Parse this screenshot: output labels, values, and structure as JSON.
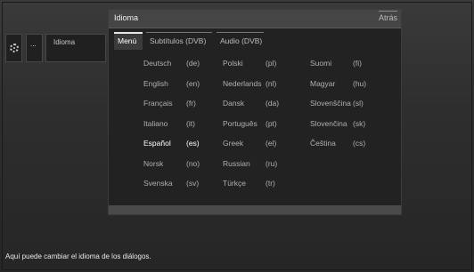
{
  "breadcrumb": {
    "item3_label": "Idioma",
    "item2_label": "..."
  },
  "panel": {
    "title": "Idioma",
    "back_label": "Atrás"
  },
  "tabs": [
    {
      "label": "Menú",
      "active": true
    },
    {
      "label": "Subtítulos (DVB)",
      "active": false
    },
    {
      "label": "Audio (DVB)",
      "active": false
    }
  ],
  "languages": {
    "col1": [
      {
        "name": "Deutsch",
        "code": "(de)"
      },
      {
        "name": "English",
        "code": "(en)"
      },
      {
        "name": "Français",
        "code": "(fr)"
      },
      {
        "name": "Italiano",
        "code": "(it)"
      },
      {
        "name": "Español",
        "code": "(es)",
        "selected": true
      },
      {
        "name": "Norsk",
        "code": "(no)"
      },
      {
        "name": "Svenska",
        "code": "(sv)"
      }
    ],
    "col2": [
      {
        "name": "Polski",
        "code": "(pl)"
      },
      {
        "name": "Nederlands",
        "code": "(nl)"
      },
      {
        "name": "Dansk",
        "code": "(da)"
      },
      {
        "name": "Português",
        "code": "(pt)"
      },
      {
        "name": "Greek",
        "code": "(el)"
      },
      {
        "name": "Russian",
        "code": "(ru)"
      },
      {
        "name": "Türkçe",
        "code": "(tr)"
      }
    ],
    "col3": [
      {
        "name": "Suomi",
        "code": "(fi)"
      },
      {
        "name": "Magyar",
        "code": "(hu)"
      },
      {
        "name": "Slovenščina",
        "code": "(sl)"
      },
      {
        "name": "Slovenčina",
        "code": "(sk)"
      },
      {
        "name": "Čeština",
        "code": "(cs)"
      }
    ]
  },
  "status": {
    "help_text": "Aquí puede cambiar el idioma de los diálogos."
  }
}
